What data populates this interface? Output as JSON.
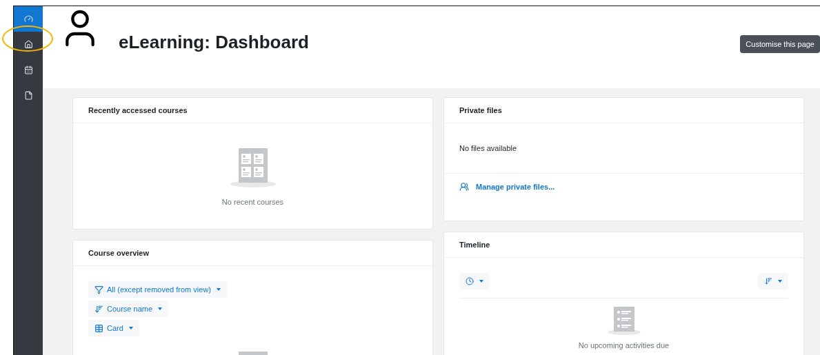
{
  "sidebar": {
    "items": [
      {
        "kind": "dashboard",
        "selected": true,
        "highlighted": false
      },
      {
        "kind": "home",
        "selected": false,
        "highlighted": true
      },
      {
        "kind": "calendar",
        "selected": false,
        "highlighted": false
      },
      {
        "kind": "file",
        "selected": false,
        "highlighted": false
      }
    ]
  },
  "header": {
    "title": "eLearning: Dashboard",
    "button": "Customise this page"
  },
  "left_column": [
    {
      "kind": "recent",
      "title": "Recently accessed courses",
      "message": "No recent courses"
    },
    {
      "kind": "overview",
      "title": "Course overview",
      "filters": [
        {
          "kind": "filter",
          "label": "All (except removed from view)"
        },
        {
          "kind": "sort",
          "label": "Course name"
        },
        {
          "kind": "grid",
          "label": "Card"
        }
      ]
    }
  ],
  "right_column": [
    {
      "kind": "files",
      "title": "Private files",
      "message": "No files available",
      "link": "Manage private files..."
    },
    {
      "kind": "timeline",
      "title": "Timeline",
      "message": "No upcoming activities due"
    }
  ]
}
